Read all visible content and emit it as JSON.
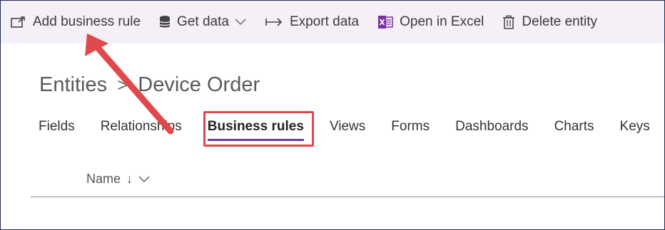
{
  "toolbar": {
    "items": [
      {
        "label": "Add business rule",
        "icon": "add-rule-icon"
      },
      {
        "label": "Get data",
        "icon": "database-icon"
      },
      {
        "label": "Export data",
        "icon": "export-arrow-icon"
      },
      {
        "label": "Open in Excel",
        "icon": "excel-icon"
      },
      {
        "label": "Delete entity",
        "icon": "trash-icon"
      }
    ]
  },
  "breadcrumb": {
    "root": "Entities",
    "separator": ">",
    "current": "Device Order"
  },
  "tabs": [
    {
      "label": "Fields"
    },
    {
      "label": "Relationships"
    },
    {
      "label": "Business rules",
      "active": true
    },
    {
      "label": "Views"
    },
    {
      "label": "Forms"
    },
    {
      "label": "Dashboards"
    },
    {
      "label": "Charts"
    },
    {
      "label": "Keys"
    }
  ],
  "list": {
    "column_name": "Name",
    "sort_glyph": "↓"
  },
  "colors": {
    "toolbar_bg": "#f5f0f8",
    "accent": "#6b3fa0",
    "annotation_red": "#e0494c",
    "excel_green": "#7a2fa0"
  }
}
